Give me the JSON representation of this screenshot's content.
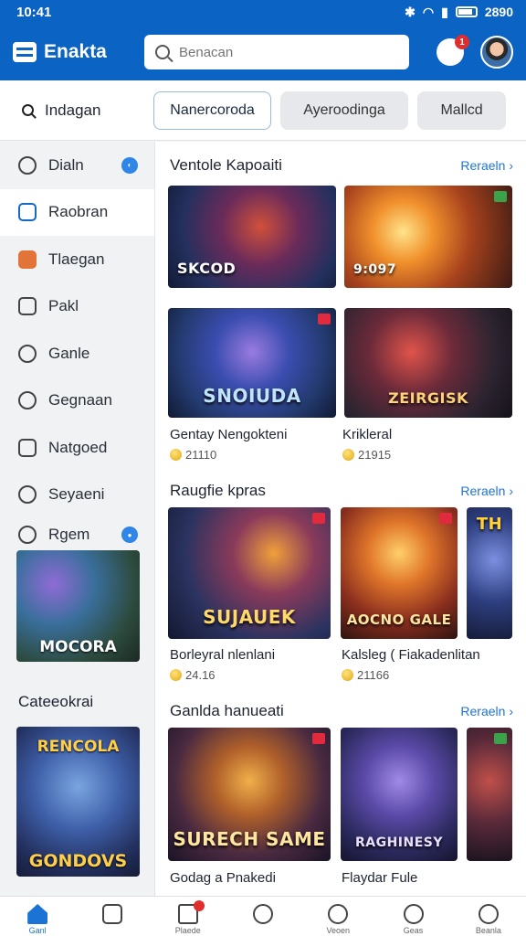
{
  "status": {
    "time": "10:41",
    "battery": "2890"
  },
  "header": {
    "app_name": "Enakta",
    "search_placeholder": "Benacan",
    "chat_badge": "1"
  },
  "filter_bar": {
    "label": "Indagan",
    "tabs": [
      "Nanercoroda",
      "Ayeroodinga",
      "Mallcd"
    ]
  },
  "sidebar": {
    "items": [
      {
        "label": "Dialn",
        "icon": "controller-icon"
      },
      {
        "label": "Raobran",
        "icon": "edit-icon"
      },
      {
        "label": "Tlaegan",
        "icon": "shop-icon"
      },
      {
        "label": "Pakl",
        "icon": "calendar-icon"
      },
      {
        "label": "Ganle",
        "icon": "game-icon"
      },
      {
        "label": "Gegnaan",
        "icon": "globe-icon"
      },
      {
        "label": "Natgoed",
        "icon": "document-icon"
      },
      {
        "label": "Seyaeni",
        "icon": "link-icon"
      },
      {
        "label": "Rgem",
        "icon": "gem-icon"
      }
    ],
    "promo_card_caption": "MOCORA",
    "categories_title": "Cateeokrai",
    "category_card_top": "RENCOLA",
    "category_card_bottom": "GONDOVS"
  },
  "sections": [
    {
      "title": "Ventole Kapoaiti",
      "more": "Reraeln",
      "games": [
        {
          "logo": "SKCOD",
          "name": "",
          "price": ""
        },
        {
          "logo": "9:097",
          "name": "",
          "price": ""
        },
        {
          "logo": "SNOIUDA",
          "name": "Gentay Nengokteni",
          "price": "21110"
        },
        {
          "logo": "ZEIRGISK",
          "name": "Krikleral",
          "price": "21915"
        }
      ]
    },
    {
      "title": "Raugfie kpras",
      "more": "Reraeln",
      "games": [
        {
          "logo": "SUJAUEK",
          "name": "Borleyral nlenlani",
          "price": "24.16"
        },
        {
          "logo": "AOCNO GALE",
          "name": "Kalsleg ( Fiakadenlitan",
          "price": "21166"
        },
        {
          "logo": "TH",
          "name": "",
          "price": ""
        }
      ]
    },
    {
      "title": "Ganlda hanueati",
      "more": "Reraeln",
      "games": [
        {
          "logo": "SURECH SAME",
          "name": "Godag a Pnakedi",
          "price": ""
        },
        {
          "logo": "RAGHINESY",
          "name": "Flaydar Fule",
          "price": ""
        },
        {
          "logo": "",
          "name": "",
          "price": ""
        }
      ]
    }
  ],
  "bottom_nav": [
    {
      "label": "Ganl",
      "icon": "home-icon"
    },
    {
      "label": "",
      "icon": "chat-icon"
    },
    {
      "label": "Plaede",
      "icon": "inbox-icon"
    },
    {
      "label": "",
      "icon": "explore-icon"
    },
    {
      "label": "Veoen",
      "icon": "clock-icon"
    },
    {
      "label": "Geas",
      "icon": "search-icon"
    },
    {
      "label": "Beanla",
      "icon": "profile-icon"
    }
  ],
  "colors": {
    "brand": "#0b63c4",
    "link": "#1f74d8",
    "badge": "#e02d2d"
  }
}
